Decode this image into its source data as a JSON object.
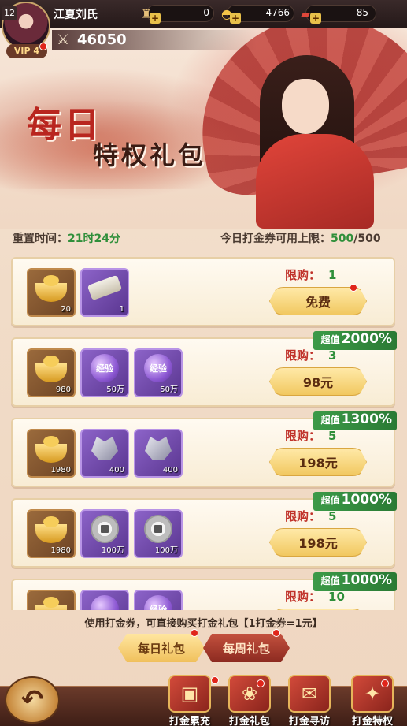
{
  "header": {
    "player_name": "江夏刘氏",
    "level": "12",
    "vip_label": "VIP",
    "vip_level": "4",
    "power": "46050",
    "resources": [
      {
        "icon": "token-icon",
        "value": "0"
      },
      {
        "icon": "gold-ingot-icon",
        "value": "4766"
      },
      {
        "icon": "ticket-icon",
        "value": "85"
      }
    ]
  },
  "banner": {
    "title_line1": "每日",
    "title_line2": "特权礼包"
  },
  "info": {
    "reset_label": "重置时间：",
    "reset_value": "21时24分",
    "limit_label": "今日打金券可用上限：",
    "limit_used": "500",
    "limit_sep": "/",
    "limit_total": "500"
  },
  "packages": [
    {
      "limit_label": "限购：",
      "limit": "1",
      "price": "免费",
      "tag_label": "",
      "tag_pct": "",
      "items": [
        {
          "kind": "ingot",
          "name": "gold-ingot-item",
          "qty": "20"
        },
        {
          "kind": "scroll",
          "name": "scroll-item",
          "qty": "1"
        }
      ]
    },
    {
      "limit_label": "限购：",
      "limit": "3",
      "price": "98元",
      "tag_label": "超值",
      "tag_pct": "2000%",
      "items": [
        {
          "kind": "ingot",
          "name": "gold-ingot-item",
          "qty": "980"
        },
        {
          "kind": "exp",
          "name": "exp-orb-item",
          "label": "经验",
          "qty": "50万"
        },
        {
          "kind": "exp",
          "name": "exp-orb-item",
          "label": "经验",
          "qty": "50万"
        }
      ]
    },
    {
      "limit_label": "限购：",
      "limit": "5",
      "price": "198元",
      "tag_label": "超值",
      "tag_pct": "1300%",
      "items": [
        {
          "kind": "ingot",
          "name": "gold-ingot-item",
          "qty": "1980"
        },
        {
          "kind": "crystal",
          "name": "crystal-item",
          "qty": "400"
        },
        {
          "kind": "crystal",
          "name": "crystal-item",
          "qty": "400"
        }
      ]
    },
    {
      "limit_label": "限购：",
      "limit": "5",
      "price": "198元",
      "tag_label": "超值",
      "tag_pct": "1000%",
      "items": [
        {
          "kind": "ingot",
          "name": "gold-ingot-item",
          "qty": "1980"
        },
        {
          "kind": "coin",
          "name": "coin-item",
          "qty": "100万"
        },
        {
          "kind": "coin",
          "name": "coin-item",
          "qty": "100万"
        }
      ]
    },
    {
      "limit_label": "限购：",
      "limit": "10",
      "price": "",
      "tag_label": "超值",
      "tag_pct": "1000%",
      "items": [
        {
          "kind": "ingot",
          "name": "gold-ingot-item",
          "qty": ""
        },
        {
          "kind": "exp",
          "name": "exp-orb-item",
          "label": "",
          "qty": ""
        },
        {
          "kind": "exp",
          "name": "exp-orb-item",
          "label": "经验",
          "qty": ""
        }
      ]
    }
  ],
  "tip": "使用打金券，可直接购买打金礼包【1打金券=1元】",
  "tabs": {
    "daily": "每日礼包",
    "weekly": "每周礼包"
  },
  "bottom_nav": [
    {
      "label": "打金累充",
      "icon": "treasure-chest-icon"
    },
    {
      "label": "打金礼包",
      "icon": "gift-bag-icon"
    },
    {
      "label": "打金寻访",
      "icon": "card-search-icon"
    },
    {
      "label": "打金特权",
      "icon": "privilege-envelope-icon"
    }
  ],
  "colors": {
    "accent_red": "#c0322a",
    "accent_green": "#2f8f3a",
    "gold": "#f1c860"
  }
}
